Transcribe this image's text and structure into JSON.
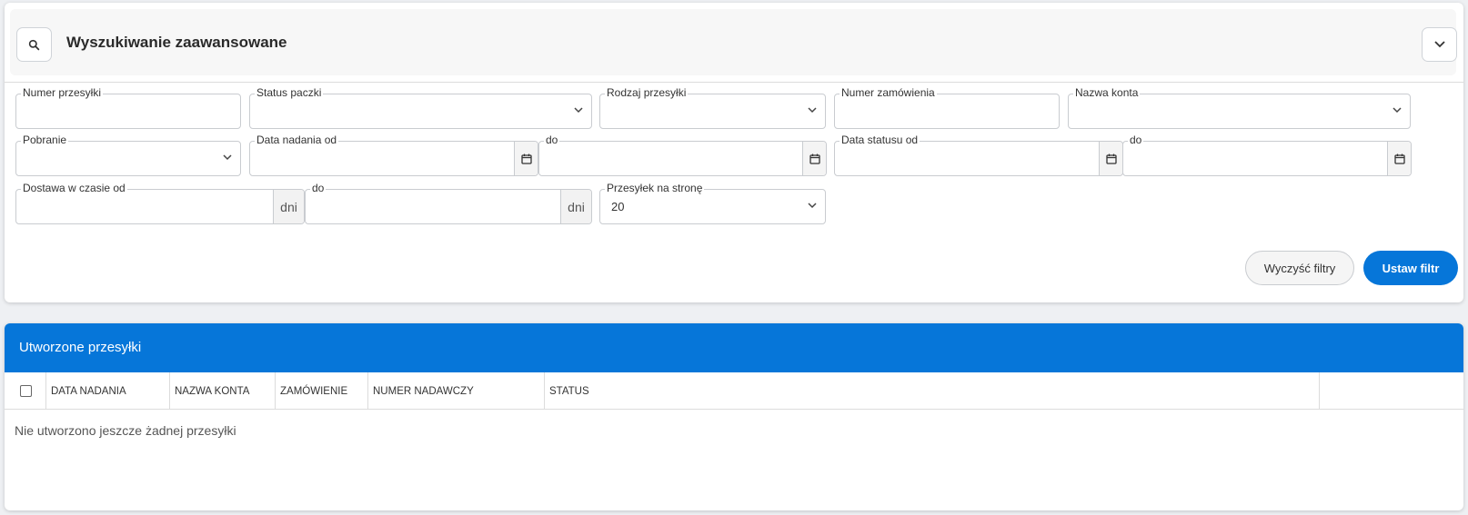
{
  "search": {
    "title": "Wyszukiwanie zaawansowane",
    "fields": {
      "numer_przesylki": "Numer przesyłki",
      "status_paczki": "Status paczki",
      "rodzaj_przesylki": "Rodzaj przesyłki",
      "numer_zamowienia": "Numer zamówienia",
      "nazwa_konta": "Nazwa konta",
      "pobranie": "Pobranie",
      "data_nadania_od": "Data nadania od",
      "data_nadania_do": "do",
      "data_statusu_od": "Data statusu od",
      "data_statusu_do": "do",
      "dostawa_od": "Dostawa w czasie od",
      "dostawa_do": "do",
      "dni_unit": "dni",
      "per_page_label": "Przesyłek na stronę",
      "per_page_value": "20"
    },
    "buttons": {
      "clear": "Wyczyść filtry",
      "apply": "Ustaw filtr"
    }
  },
  "shipments": {
    "title": "Utworzone przesyłki",
    "columns": [
      "DATA NADANIA",
      "NAZWA KONTA",
      "ZAMÓWIENIE",
      "NUMER NADAWCZY",
      "STATUS"
    ],
    "empty_message": "Nie utworzono jeszcze żadnej przesyłki"
  },
  "colors": {
    "primary": "#0676d9",
    "header_bg": "#f7f7f7"
  }
}
